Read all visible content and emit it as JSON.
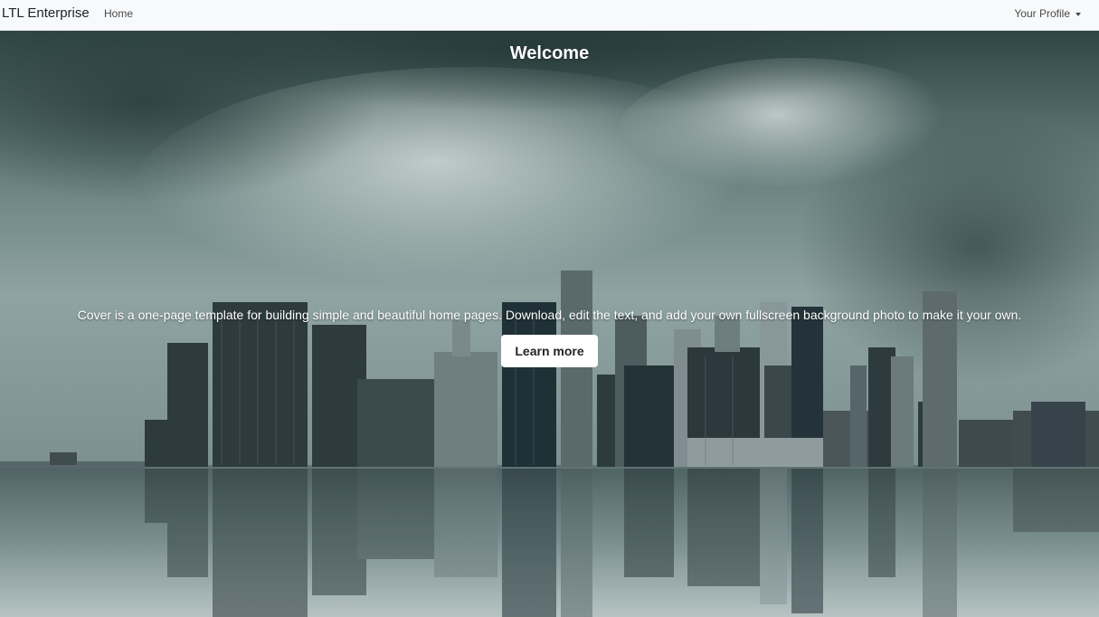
{
  "navbar": {
    "brand": "LTL Enterprise",
    "home_label": "Home",
    "profile_label": "Your Profile"
  },
  "hero": {
    "title": "Welcome",
    "lead": "Cover is a one-page template for building simple and beautiful home pages. Download, edit the text, and add your own fullscreen background photo to make it your own.",
    "cta_label": "Learn more"
  },
  "colors": {
    "navbar_bg": "#f8f9fa",
    "hero_text": "#ffffff",
    "button_bg": "#ffffff",
    "button_text": "#212529"
  },
  "icons": {
    "profile_toggle": "caret-down-icon"
  }
}
